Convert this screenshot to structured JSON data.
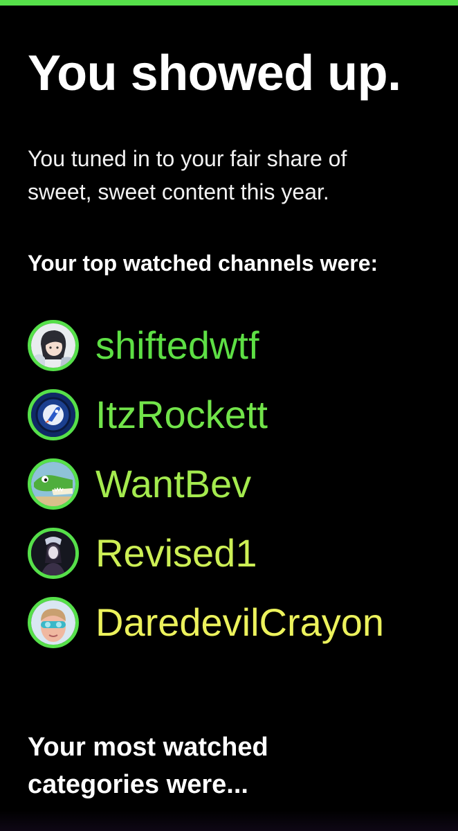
{
  "accent_color": "#56e04a",
  "headline": "You showed up.",
  "subtext": "You tuned in to your fair share of sweet, sweet content this year.",
  "channels_title": "Your top watched channels were:",
  "channels": [
    {
      "name": "shiftedwtf",
      "color": "#5ddf44",
      "avatar_icon": "anime-girl-avatar-icon"
    },
    {
      "name": "ItzRockett",
      "color": "#72e44a",
      "avatar_icon": "rocket-avatar-icon"
    },
    {
      "name": "WantBev",
      "color": "#a4ea4e",
      "avatar_icon": "crocodile-avatar-icon"
    },
    {
      "name": "Revised1",
      "color": "#cdef55",
      "avatar_icon": "dark-character-avatar-icon"
    },
    {
      "name": "DaredevilCrayon",
      "color": "#ecf25c",
      "avatar_icon": "person-goggles-avatar-icon"
    }
  ],
  "categories_title": "Your most watched categories were..."
}
